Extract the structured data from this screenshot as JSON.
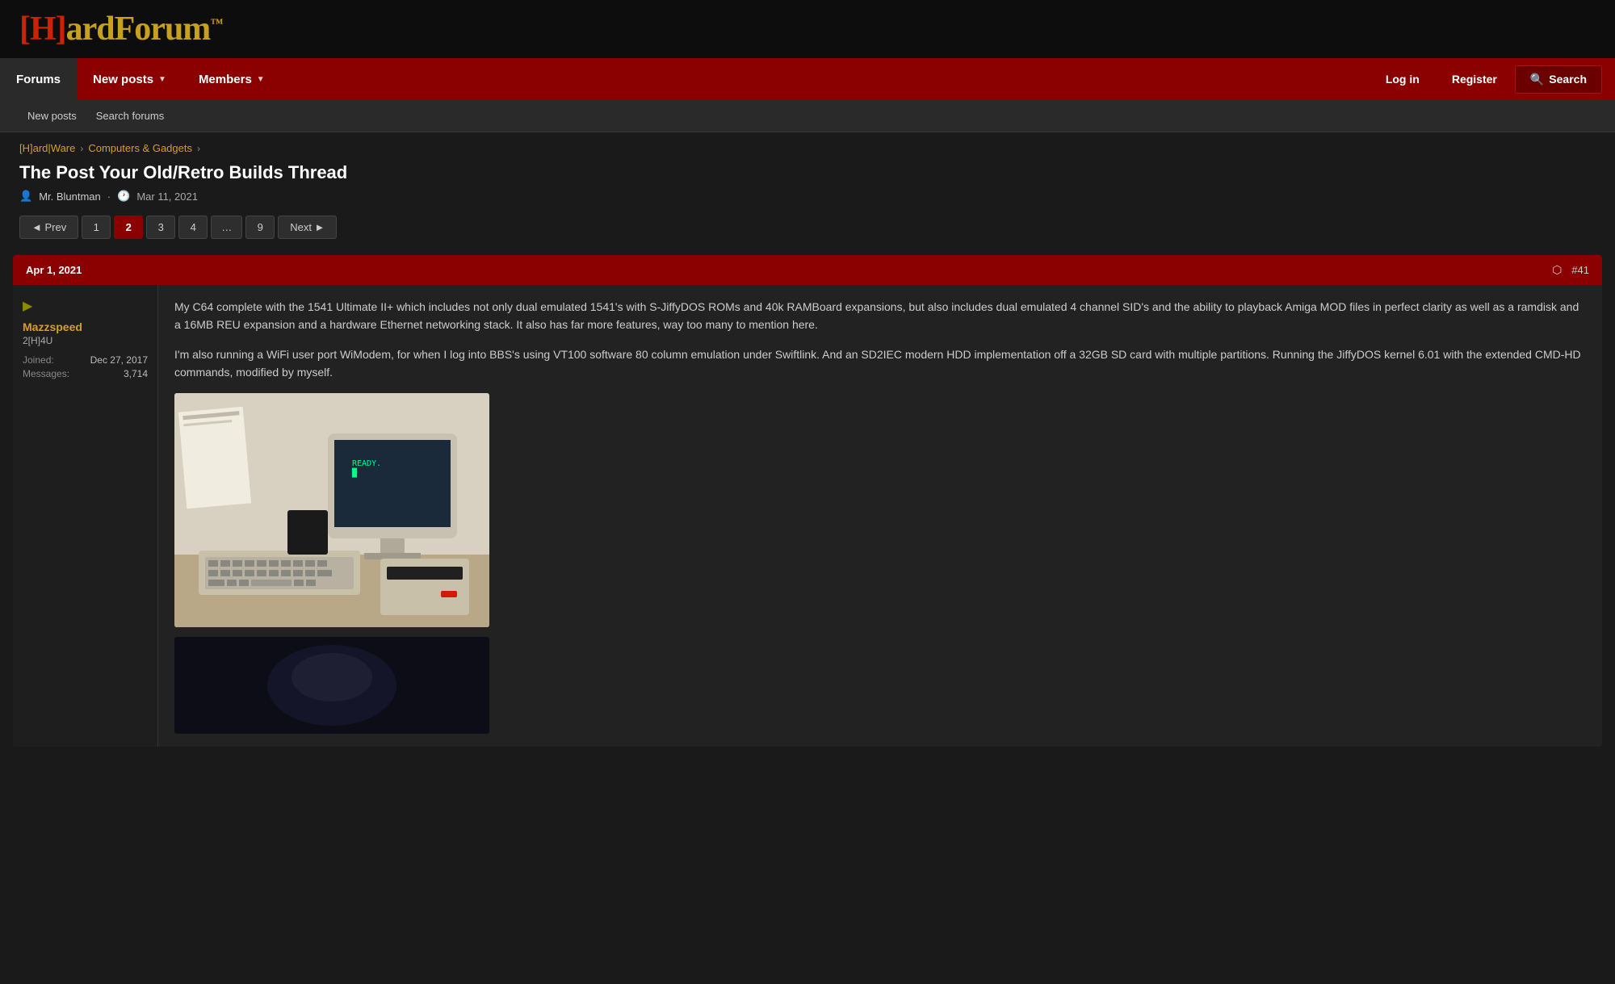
{
  "site": {
    "logo_bracket": "[H]",
    "logo_text": "ardForum",
    "logo_tm": "™"
  },
  "nav": {
    "items": [
      {
        "id": "forums",
        "label": "Forums",
        "active": true,
        "has_dropdown": false
      },
      {
        "id": "new-posts",
        "label": "New posts",
        "active": false,
        "has_dropdown": true
      },
      {
        "id": "members",
        "label": "Members",
        "active": false,
        "has_dropdown": true
      }
    ],
    "right_buttons": [
      {
        "id": "login",
        "label": "Log in"
      },
      {
        "id": "register",
        "label": "Register"
      }
    ],
    "search_label": "Search"
  },
  "subnav": {
    "items": [
      {
        "id": "new-posts-sub",
        "label": "New posts"
      },
      {
        "id": "search-forums",
        "label": "Search forums"
      }
    ]
  },
  "breadcrumb": {
    "items": [
      {
        "id": "hardware",
        "label": "[H]ard|Ware"
      },
      {
        "id": "computers-gadgets",
        "label": "Computers & Gadgets"
      }
    ]
  },
  "thread": {
    "title": "The Post Your Old/Retro Builds Thread",
    "author": "Mr. Bluntman",
    "date": "Mar 11, 2021"
  },
  "pagination": {
    "prev_label": "◄ Prev",
    "next_label": "Next ►",
    "pages": [
      "1",
      "2",
      "3",
      "4",
      "…",
      "9"
    ],
    "current_page": "2"
  },
  "post": {
    "date": "Apr 1, 2021",
    "number": "#41",
    "user": {
      "name": "Mazzspeed",
      "rank": "2[H]4U",
      "joined_label": "Joined:",
      "joined_date": "Dec 27, 2017",
      "messages_label": "Messages:",
      "messages_count": "3,714"
    },
    "paragraphs": [
      "My C64 complete with the 1541 Ultimate II+ which includes not only dual emulated 1541's with S-JiffyDOS ROMs and 40k RAMBoard expansions, but also includes dual emulated 4 channel SID's and the ability to playback Amiga MOD files in perfect clarity as well as a ramdisk and a 16MB REU expansion and a hardware Ethernet networking stack. It also has far more features, way too many to mention here.",
      "I'm also running a WiFi user port WiModem, for when I log into BBS's using VT100 software 80 column emulation under Swiftlink. And an SD2IEC modern HDD implementation off a 32GB SD card with multiple partitions. Running the JiffyDOS kernel 6.01 with the extended CMD-HD commands, modified by myself."
    ],
    "image_alt": "Commodore 64 setup with monitor, keyboard and disk drive",
    "image2_alt": "Dark retro computer image"
  }
}
